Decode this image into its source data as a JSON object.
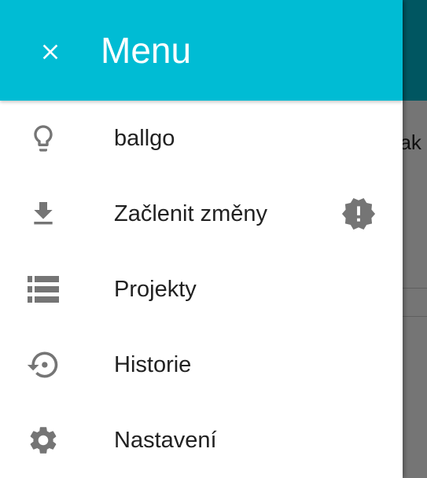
{
  "background": {
    "partial_text": "bak"
  },
  "drawer": {
    "title": "Menu",
    "items": [
      {
        "label": "ballgo",
        "icon": "lightbulb-icon"
      },
      {
        "label": "Začlenit změny",
        "icon": "download-icon",
        "badge": "alert-badge-icon"
      },
      {
        "label": "Projekty",
        "icon": "list-icon"
      },
      {
        "label": "Historie",
        "icon": "history-icon"
      },
      {
        "label": "Nastavení",
        "icon": "settings-gear-icon"
      }
    ]
  },
  "colors": {
    "accent": "#00bcd4",
    "icon": "#757575",
    "text": "#212121"
  }
}
